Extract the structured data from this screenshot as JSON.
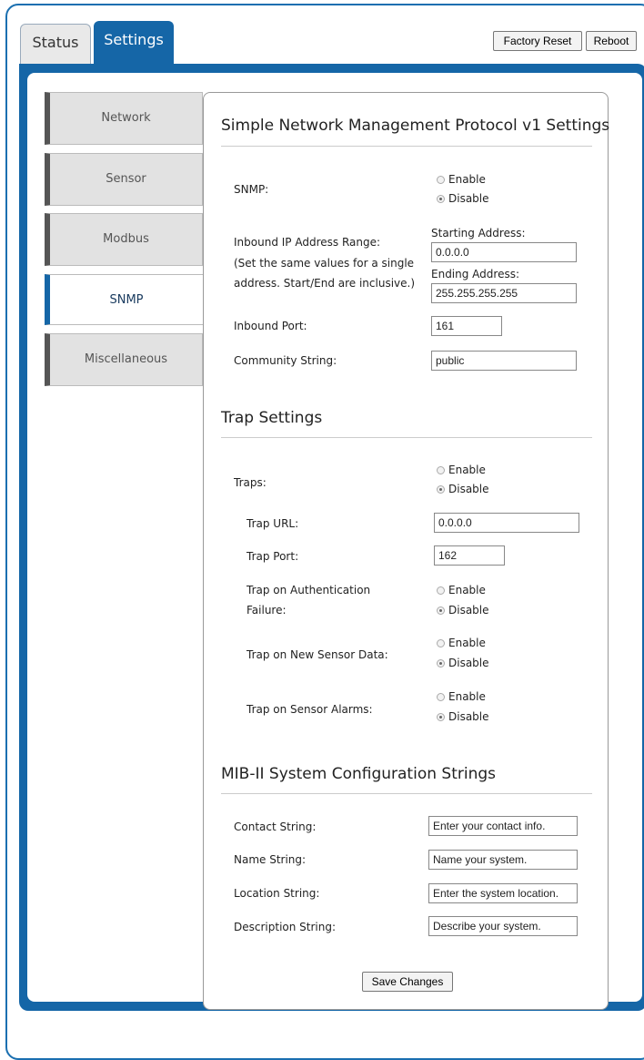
{
  "tabs": {
    "status": "Status",
    "settings": "Settings"
  },
  "header_buttons": {
    "factory_reset": "Factory Reset",
    "reboot": "Reboot"
  },
  "sidebar": {
    "items": [
      {
        "label": "Network",
        "active": false
      },
      {
        "label": "Sensor",
        "active": false
      },
      {
        "label": "Modbus",
        "active": false
      },
      {
        "label": "SNMP",
        "active": true
      },
      {
        "label": "Miscellaneous",
        "active": false
      }
    ]
  },
  "snmp": {
    "title": "Simple Network Management Protocol v1 Settings",
    "snmp_label": "SNMP:",
    "enable": "Enable",
    "disable": "Disable",
    "snmp_selected": "Disable",
    "range_label_1": "Inbound IP Address Range:",
    "range_label_2": "(Set the same values for a single",
    "range_label_3": "address. Start/End are inclusive.)",
    "start_label": "Starting Address:",
    "start_value": "0.0.0.0",
    "end_label": "Ending Address:",
    "end_value": "255.255.255.255",
    "port_label": "Inbound Port:",
    "port_value": "161",
    "community_label": "Community String:",
    "community_value": "public"
  },
  "trap": {
    "title": "Trap Settings",
    "traps_label": "Traps:",
    "traps_selected": "Disable",
    "url_label": "Trap URL:",
    "url_value": "0.0.0.0",
    "port_label": "Trap Port:",
    "port_value": "162",
    "auth_label_1": "Trap on Authentication",
    "auth_label_2": "Failure:",
    "auth_selected": "Disable",
    "new_data_label": "Trap on New Sensor Data:",
    "new_data_selected": "Disable",
    "alarms_label": "Trap on Sensor Alarms:",
    "alarms_selected": "Disable"
  },
  "mib": {
    "title": "MIB-II System Configuration Strings",
    "contact_label": "Contact String:",
    "contact_value": "Enter your contact info.",
    "name_label": "Name String:",
    "name_value": "Name your system.",
    "location_label": "Location String:",
    "location_value": "Enter the system location.",
    "description_label": "Description String:",
    "description_value": "Describe your system."
  },
  "save_label": "Save Changes",
  "colors": {
    "accent": "#1566a7",
    "frame": "#1a6fb0"
  }
}
